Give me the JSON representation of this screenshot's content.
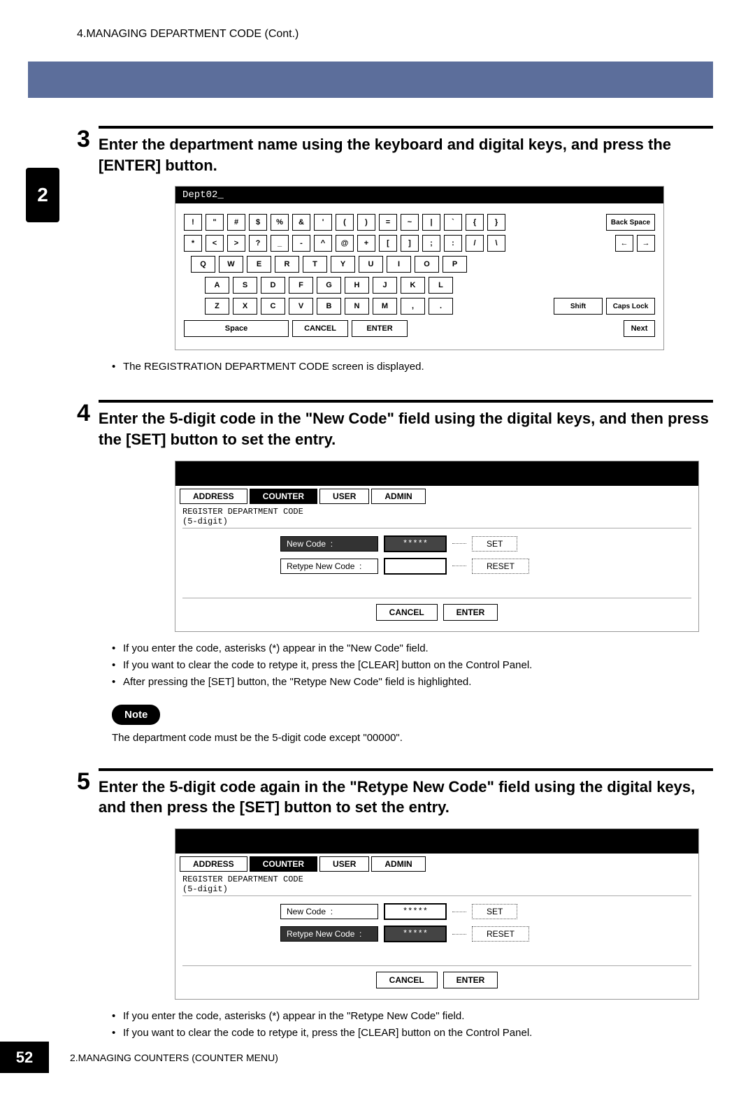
{
  "header": "4.MANAGING DEPARTMENT CODE (Cont.)",
  "side_tab": "2",
  "steps": {
    "s3": {
      "num": "3",
      "title": "Enter the department name using the keyboard and digital keys, and press the [ENTER] button.",
      "kb": {
        "input": "Dept02_",
        "row1": [
          "!",
          "\"",
          "#",
          "$",
          "%",
          "&",
          "'",
          "(",
          ")",
          "=",
          "~",
          "|",
          "`",
          "{",
          "}"
        ],
        "row1_right": "Back Space",
        "row2": [
          "*",
          "<",
          ">",
          "?",
          "_",
          "-",
          "^",
          "@",
          "+",
          "[",
          "]",
          ";",
          ":",
          "/",
          "\\"
        ],
        "row2_right": [
          "←",
          "→"
        ],
        "row3": [
          "Q",
          "W",
          "E",
          "R",
          "T",
          "Y",
          "U",
          "I",
          "O",
          "P"
        ],
        "row4": [
          "A",
          "S",
          "D",
          "F",
          "G",
          "H",
          "J",
          "K",
          "L"
        ],
        "row5": [
          "Z",
          "X",
          "C",
          "V",
          "B",
          "N",
          "M",
          ",",
          "."
        ],
        "row5_right": [
          "Shift",
          "Caps Lock"
        ],
        "row6": [
          "Space",
          "CANCEL",
          "ENTER"
        ],
        "row6_right": "Next"
      },
      "bullets": [
        "The REGISTRATION DEPARTMENT CODE screen is displayed."
      ]
    },
    "s4": {
      "num": "4",
      "title": "Enter the 5-digit code in the \"New Code\" field using the digital keys, and then press the [SET] button to set the entry.",
      "reg": {
        "tabs": [
          "ADDRESS",
          "COUNTER",
          "USER",
          "ADMIN"
        ],
        "active_tab": "COUNTER",
        "subtitle": "REGISTER DEPARTMENT CODE",
        "subtitle2": "(5-digit)",
        "new_code_label": "New Code",
        "new_code_value": "*****",
        "new_code_active": true,
        "retype_label": "Retype New Code",
        "retype_value": "",
        "retype_active": false,
        "set": "SET",
        "reset": "RESET",
        "cancel": "CANCEL",
        "enter": "ENTER"
      },
      "bullets": [
        "If you enter the code, asterisks (*) appear in the \"New Code\" field.",
        "If you want to clear the code to retype it, press the [CLEAR] button on the Control Panel.",
        "After pressing the [SET] button, the \"Retype New Code\" field is highlighted."
      ],
      "note_label": "Note",
      "note_text": "The department code must be the 5-digit code except \"00000\"."
    },
    "s5": {
      "num": "5",
      "title": "Enter the 5-digit code again in the \"Retype New Code\" field using the digital keys, and then press the [SET] button to set the entry.",
      "reg": {
        "tabs": [
          "ADDRESS",
          "COUNTER",
          "USER",
          "ADMIN"
        ],
        "active_tab": "COUNTER",
        "subtitle": "REGISTER DEPARTMENT CODE",
        "subtitle2": "(5-digit)",
        "new_code_label": "New Code",
        "new_code_value": "*****",
        "new_code_active": false,
        "retype_label": "Retype New Code",
        "retype_value": "*****",
        "retype_active": true,
        "set": "SET",
        "reset": "RESET",
        "cancel": "CANCEL",
        "enter": "ENTER"
      },
      "bullets": [
        "If you enter the code, asterisks (*) appear in the \"Retype New Code\" field.",
        "If you want to clear the code to retype it, press the [CLEAR] button on the Control Panel."
      ]
    }
  },
  "footer": {
    "page": "52",
    "text": "2.MANAGING COUNTERS (COUNTER MENU)"
  }
}
